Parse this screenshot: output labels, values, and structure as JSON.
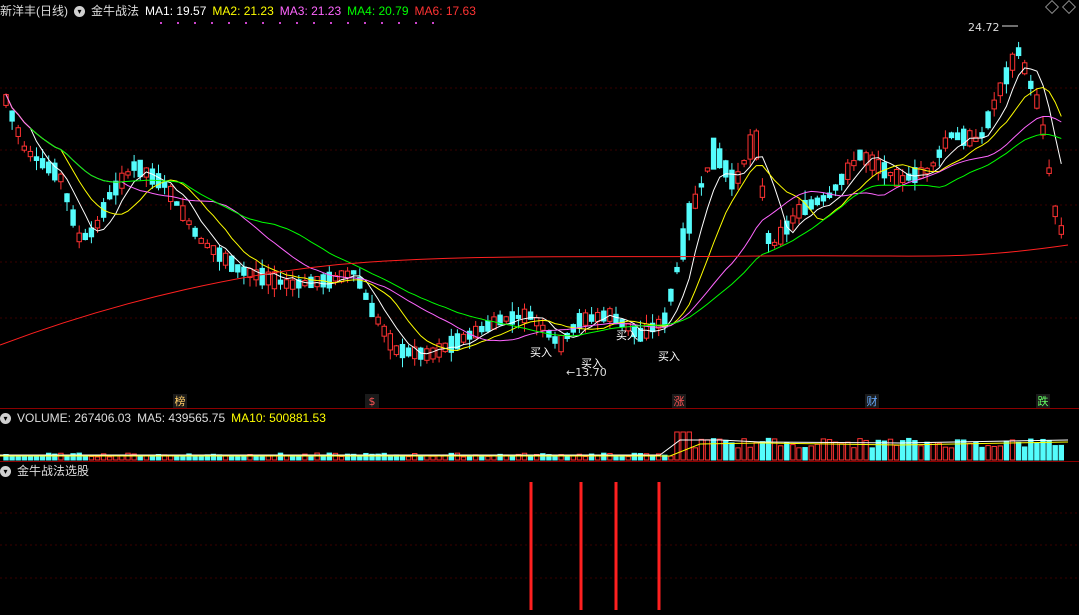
{
  "main_panel": {
    "stock_title": "新洋丰(日线)",
    "indicator_name": "金牛战法",
    "ma": [
      {
        "label": "MA1: 19.57",
        "color": "#ffffff"
      },
      {
        "label": "MA2: 21.23",
        "color": "#ffff00"
      },
      {
        "label": "MA3: 21.23",
        "color": "#ff66ff"
      },
      {
        "label": "MA4: 20.79",
        "color": "#00ff00"
      },
      {
        "label": "MA6: 17.63",
        "color": "#ff3333"
      }
    ],
    "high_label": "24.72",
    "low_label": "←13.70",
    "buy_label": "买入",
    "event_markers": [
      {
        "text": "榜",
        "color": "#ffcc66"
      },
      {
        "text": "$",
        "color": "#ff5555"
      },
      {
        "text": "涨",
        "color": "#ff5555"
      },
      {
        "text": "财",
        "color": "#66aaff"
      },
      {
        "text": "跌",
        "color": "#66ff66"
      }
    ]
  },
  "volume_panel": {
    "volume_label": "VOLUME: 267406.03",
    "ma5_label": "MA5: 439565.75",
    "ma10_label": "MA10: 500881.53"
  },
  "signal_panel": {
    "title": "金牛战法选股"
  },
  "colors": {
    "up": "#ff3232",
    "down": "#54fcfc",
    "bg": "#000000",
    "separator": "#8b0000"
  }
}
